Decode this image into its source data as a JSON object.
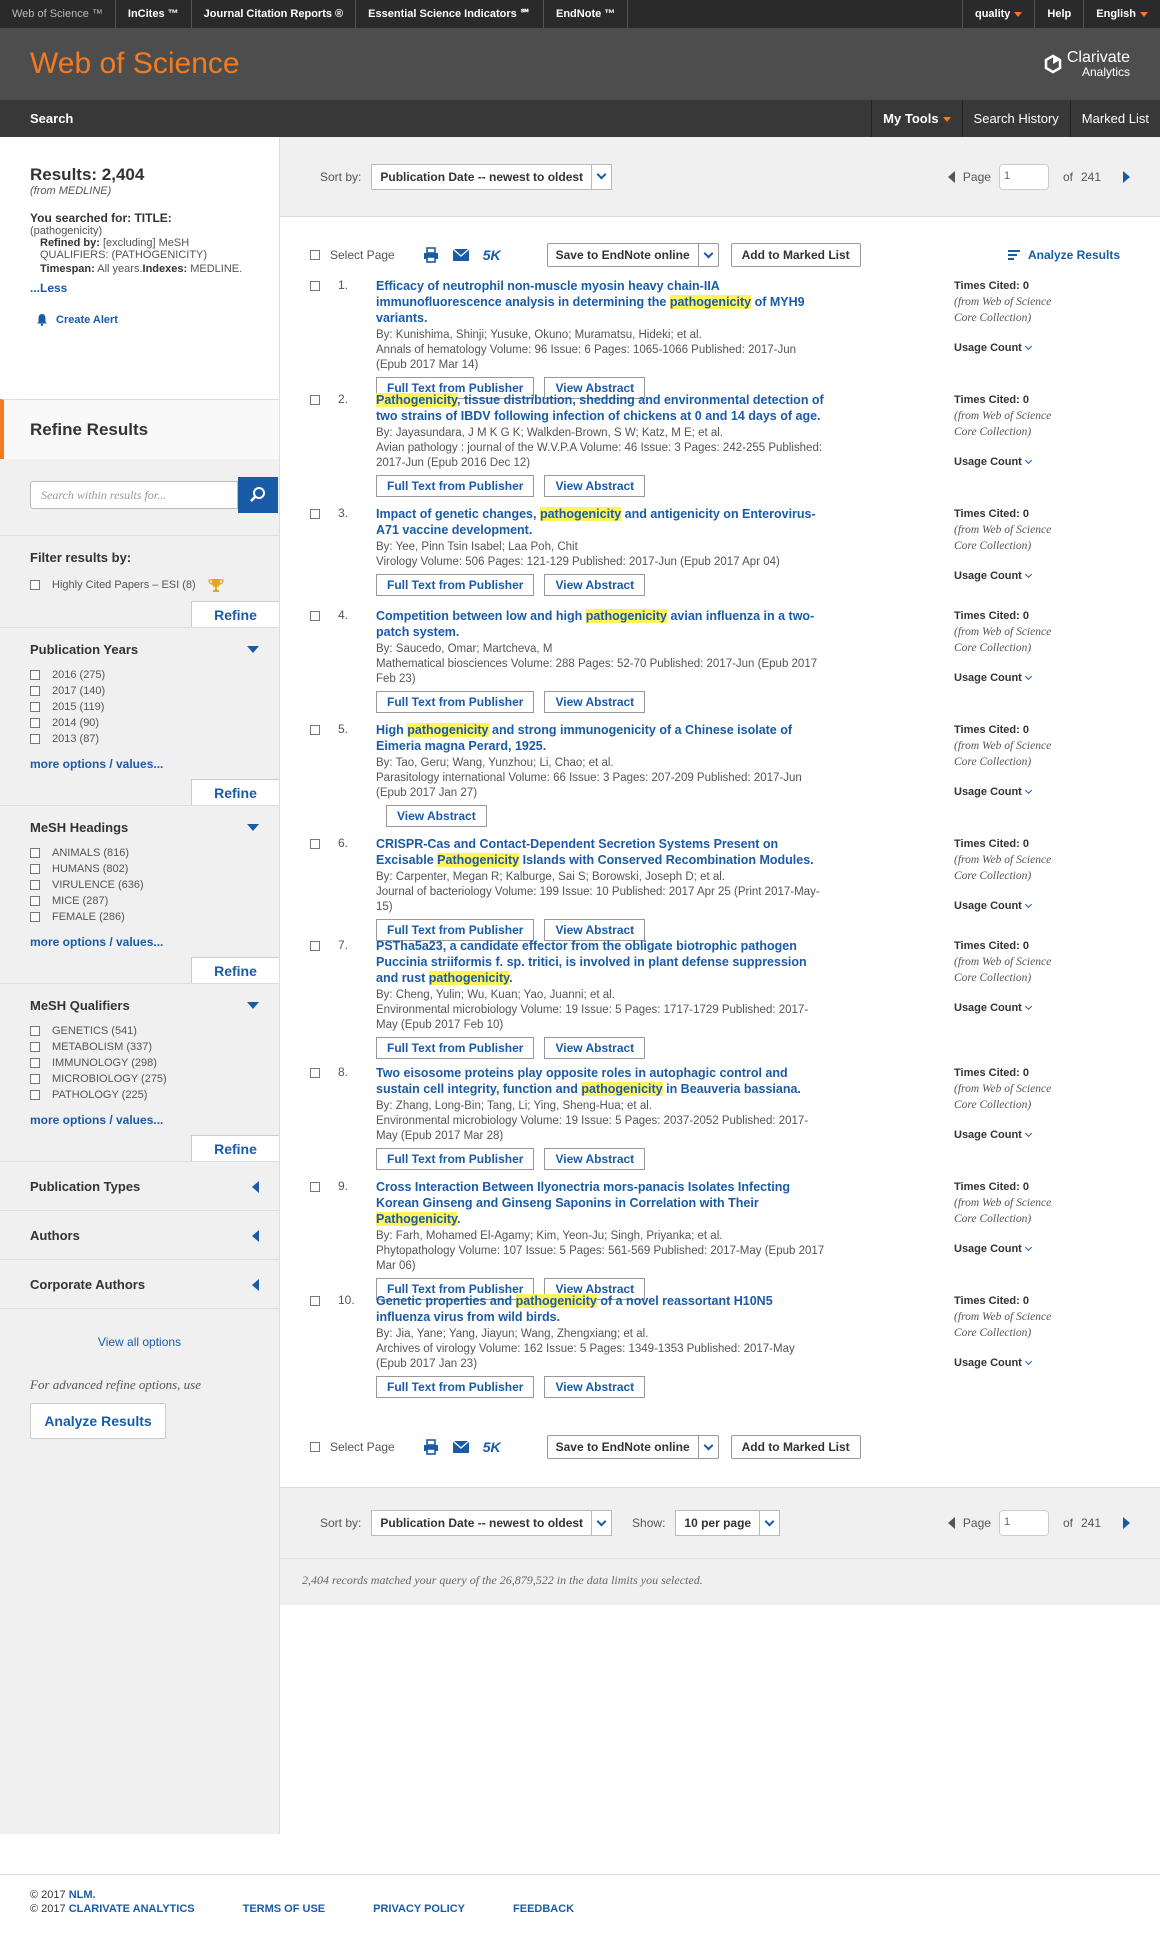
{
  "topbar": {
    "products": [
      "Web of Science ™",
      "InCites ™",
      "Journal Citation Reports ®",
      "Essential Science Indicators ℠",
      "EndNote ™"
    ],
    "right": [
      "quality",
      "Help",
      "English"
    ]
  },
  "header": {
    "logo": "Web of Science",
    "brand1": "Clarivate",
    "brand2": "Analytics"
  },
  "nav": {
    "search": "Search",
    "tools": [
      "My Tools",
      "Search History",
      "Marked List"
    ]
  },
  "sidebar": {
    "results_label": "Results: 2,404",
    "results_from": "(from MEDLINE)",
    "searched_for": "You searched for: TITLE:",
    "searched_term": "(pathogenicity)",
    "refined_by_label": "Refined by:",
    "refined_by": "[excluding] MeSH QUALIFIERS: (PATHOGENICITY)",
    "timespan_label": "Timespan:",
    "timespan": "All years.",
    "indexes_label": "Indexes:",
    "indexes": "MEDLINE.",
    "less": "...Less",
    "create_alert": "Create Alert",
    "refine_title": "Refine Results",
    "search_within_placeholder": "Search within results for...",
    "filter_by": "Filter results by:",
    "highly_cited": "Highly Cited Papers – ESI (8)",
    "refine": "Refine",
    "pub_years_title": "Publication Years",
    "pub_years": [
      "2016 (275)",
      "2017 (140)",
      "2015 (119)",
      "2014 (90)",
      "2013 (87)"
    ],
    "mesh_headings_title": "MeSH Headings",
    "mesh_headings": [
      "ANIMALS (816)",
      "HUMANS (802)",
      "VIRULENCE (636)",
      "MICE (287)",
      "FEMALE (286)"
    ],
    "mesh_qualifiers_title": "MeSH Qualifiers",
    "mesh_qualifiers": [
      "GENETICS (541)",
      "METABOLISM (337)",
      "IMMUNOLOGY (298)",
      "MICROBIOLOGY (275)",
      "PATHOLOGY (225)"
    ],
    "more_options": "more options / values...",
    "collapsed": [
      "Publication Types",
      "Authors",
      "Corporate Authors"
    ],
    "view_all": "View all options",
    "advanced": "For advanced refine options, use",
    "analyze_results": "Analyze Results"
  },
  "sort": {
    "label": "Sort by:",
    "value": "Publication Date -- newest to oldest",
    "page_label": "Page",
    "page_value": "1",
    "of": "of",
    "total_pages": "241",
    "show_label": "Show:",
    "show_value": "10 per page"
  },
  "toolbar": {
    "select_page": "Select Page",
    "k5": "5K",
    "save_endnote": "Save to EndNote online",
    "add_marked": "Add to Marked List",
    "analyze": "Analyze Results"
  },
  "labels": {
    "full_text": "Full Text from Publisher",
    "view_abstract": "View Abstract",
    "times_cited": "Times Cited: 0",
    "from_wos1": "(from Web of Science",
    "from_wos2": "Core Collection)",
    "usage_count": "Usage Count"
  },
  "records": [
    {
      "num": "1.",
      "t1": "Efficacy of neutrophil non-muscle myosin heavy chain-IIA immunofluorescence analysis in determining the ",
      "hl": "pathogenicity",
      "t2": " of MYH9 variants.",
      "authors": "By: Kunishima, Shinji; Yusuke, Okuno; Muramatsu, Hideki; et al.",
      "source": "Annals of hematology  Volume: 96   Issue: 6   Pages: 1065-1066   Published: 2017-Jun (Epub 2017 Mar 14)"
    },
    {
      "num": "2.",
      "t1": "",
      "hl": "Pathogenicity",
      "t2": ", tissue distribution, shedding and environmental detection of two strains of IBDV following infection of chickens at 0 and 14 days of age.",
      "authors": "By: Jayasundara, J M K G K; Walkden-Brown, S W; Katz, M E; et al.",
      "source": "Avian pathology : journal of the W.V.P.A  Volume: 46   Issue: 3   Pages: 242-255   Published: 2017-Jun (Epub 2016 Dec 12)"
    },
    {
      "num": "3.",
      "t1": "Impact of genetic changes, ",
      "hl": "pathogenicity",
      "t2": " and antigenicity on Enterovirus- A71 vaccine development.",
      "authors": "By: Yee, Pinn Tsin Isabel; Laa Poh, Chit",
      "source": "Virology  Volume: 506   Pages: 121-129   Published: 2017-Jun (Epub 2017 Apr 04)"
    },
    {
      "num": "4.",
      "t1": "Competition between low and high ",
      "hl": "pathogenicity",
      "t2": " avian influenza in a two-patch system.",
      "authors": "By: Saucedo, Omar; Martcheva, M",
      "source": "Mathematical biosciences  Volume: 288   Pages: 52-70   Published: 2017-Jun (Epub 2017 Feb 23)"
    },
    {
      "num": "5.",
      "t1": "High ",
      "hl": "pathogenicity",
      "t2": " and strong immunogenicity of a Chinese isolate of Eimeria magna Perard, 1925.",
      "authors": "By: Tao, Geru; Wang, Yunzhou; Li, Chao; et al.",
      "source": "Parasitology international  Volume: 66   Issue: 3   Pages: 207-209   Published: 2017-Jun (Epub 2017 Jan 27)"
    },
    {
      "num": "6.",
      "t1": "CRISPR-Cas and Contact-Dependent Secretion Systems Present on Excisable ",
      "hl": "Pathogenicity",
      "t2": " Islands with Conserved Recombination Modules.",
      "authors": "By: Carpenter, Megan R; Kalburge, Sai S; Borowski, Joseph D; et al.",
      "source": "Journal of bacteriology  Volume: 199   Issue: 10   Published: 2017 Apr 25 (Print 2017-May-15)"
    },
    {
      "num": "7.",
      "t1": "PSTha5a23, a candidate effector from the obligate biotrophic pathogen Puccinia striiformis f. sp. tritici, is involved in plant defense suppression and rust ",
      "hl": "pathogenicity",
      "t2": ".",
      "authors": "By: Cheng, Yulin; Wu, Kuan; Yao, Juanni; et al.",
      "source": "Environmental microbiology  Volume: 19   Issue: 5   Pages: 1717-1729   Published: 2017-May (Epub 2017 Feb 10)"
    },
    {
      "num": "8.",
      "t1": "Two eisosome proteins play opposite roles in autophagic control and sustain cell integrity, function and ",
      "hl": "pathogenicity",
      "t2": " in Beauveria bassiana.",
      "authors": "By: Zhang, Long-Bin; Tang, Li; Ying, Sheng-Hua; et al.",
      "source": "Environmental microbiology  Volume: 19   Issue: 5   Pages: 2037-2052   Published: 2017-May (Epub 2017 Mar 28)"
    },
    {
      "num": "9.",
      "t1": "Cross Interaction Between Ilyonectria mors-panacis Isolates Infecting Korean Ginseng and Ginseng Saponins in Correlation with Their ",
      "hl": "Pathogenicity",
      "t2": ".",
      "authors": "By: Farh, Mohamed El-Agamy; Kim, Yeon-Ju; Singh, Priyanka; et al.",
      "source": "Phytopathology  Volume: 107   Issue: 5   Pages: 561-569   Published: 2017-May (Epub 2017 Mar 06)"
    },
    {
      "num": "10.",
      "t1": "Genetic properties and ",
      "hl": "pathogenicity",
      "t2": " of a novel reassortant H10N5 influenza virus from wild birds.",
      "authors": "By: Jia, Yane; Yang, Jiayun; Wang, Zhengxiang; et al.",
      "source": "Archives of virology  Volume: 162   Issue: 5   Pages: 1349-1353   Published: 2017-May (Epub 2017 Jan 23)"
    }
  ],
  "matched": "2,404 records matched your query of the 26,879,522 in the data limits you selected.",
  "footer": {
    "line1": "© 2017",
    "nlm": "NLM.",
    "line2": "© 2017",
    "clarivate": "CLARIVATE ANALYTICS",
    "links": [
      "TERMS OF USE",
      "PRIVACY POLICY",
      "FEEDBACK"
    ]
  }
}
